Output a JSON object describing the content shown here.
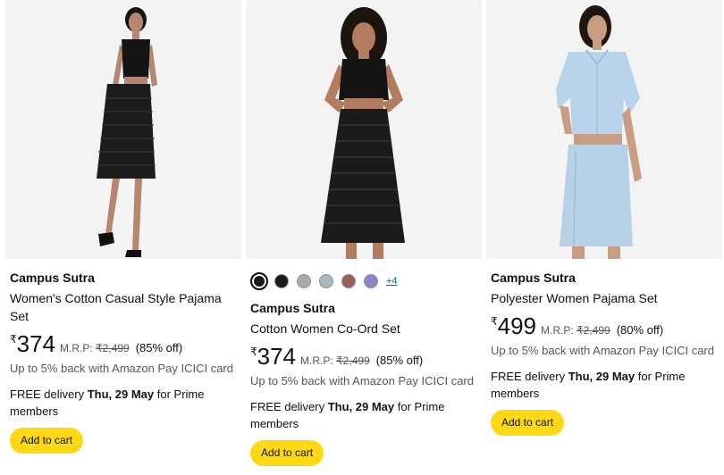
{
  "products": [
    {
      "brand": "Campus Sutra",
      "title": "Women's Cotton Casual Style Pajama Set",
      "currency": "₹",
      "price": "374",
      "mrp_label": "M.R.P:",
      "mrp": "₹2,499",
      "discount": "(85% off)",
      "offer": "Up to 5% back with Amazon Pay ICICI card",
      "delivery_prefix": "FREE delivery ",
      "delivery_date": "Thu, 29 May",
      "delivery_suffix": " for Prime members",
      "cart_label": "Add to cart"
    },
    {
      "brand": "Campus Sutra",
      "title": "Cotton Women Co-Ord Set",
      "currency": "₹",
      "price": "374",
      "mrp_label": "M.R.P:",
      "mrp": "₹2,499",
      "discount": "(85% off)",
      "offer": "Up to 5% back with Amazon Pay ICICI card",
      "delivery_prefix": "FREE delivery ",
      "delivery_date": "Thu, 29 May",
      "delivery_suffix": " for Prime members",
      "cart_label": "Add to cart",
      "swatches": [
        "#1a1a1a",
        "#1a1a1a",
        "#a9aba9",
        "#a8b8c0",
        "#9a5f58",
        "#8a86c8"
      ],
      "more_swatches": "+4"
    },
    {
      "brand": "Campus Sutra",
      "title": "Polyester Women Pajama Set",
      "currency": "₹",
      "price": "499",
      "mrp_label": "M.R.P:",
      "mrp": "₹2,499",
      "discount": "(80% off)",
      "offer": "Up to 5% back with Amazon Pay ICICI card",
      "delivery_prefix": "FREE delivery ",
      "delivery_date": "Thu, 29 May",
      "delivery_suffix": " for Prime members",
      "cart_label": "Add to cart"
    }
  ],
  "colors": {
    "cart_button": "#ffd814",
    "link": "#007185",
    "muted": "#565959",
    "image_bg": "#f3f3f3"
  }
}
